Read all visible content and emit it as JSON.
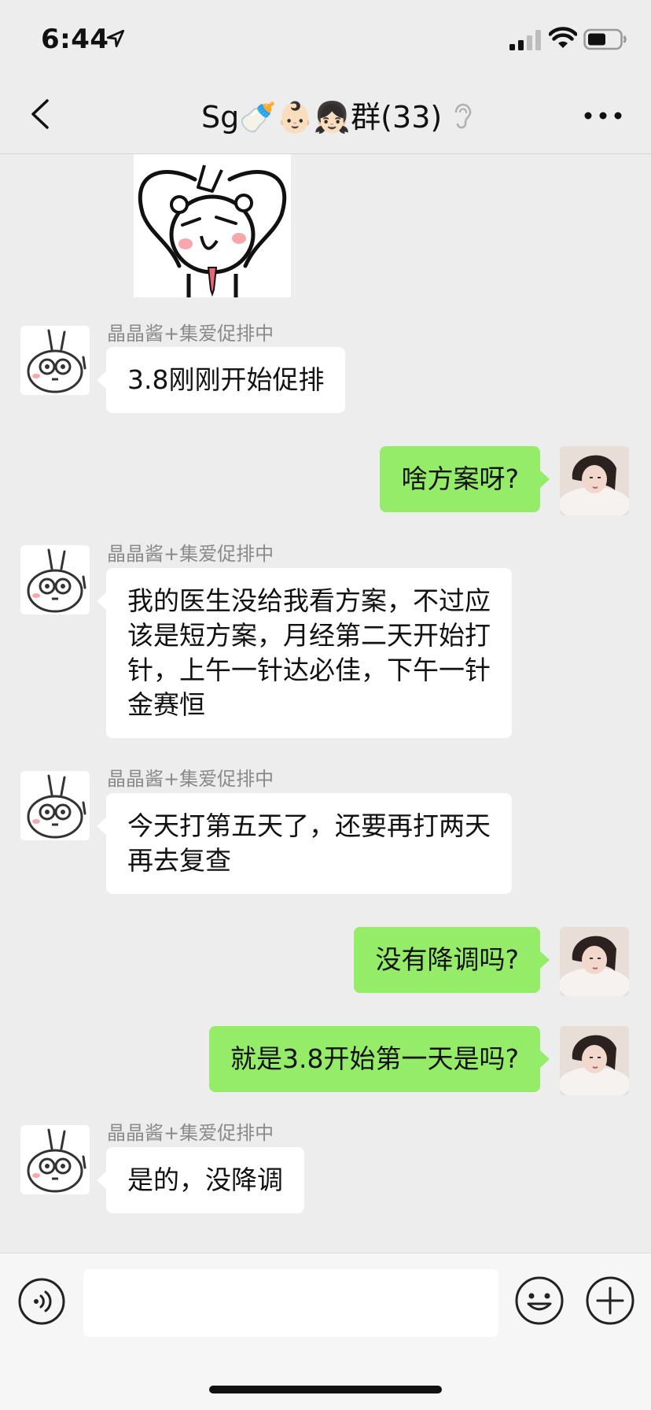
{
  "status_bar": {
    "time": "6:44",
    "icons": [
      "location-arrow-icon",
      "signal-icon",
      "wifi-icon",
      "battery-icon"
    ]
  },
  "nav": {
    "title": "Sg🍼👶🏻👧🏻群(33)",
    "back_icon": "chevron-left-icon",
    "mute_icon": "ear-icon",
    "more_icon": "ellipsis-icon"
  },
  "messages": [
    {
      "side": "in",
      "sender": "晶晶酱+集爱促排中",
      "lines": [
        "3.8刚刚开始促排"
      ]
    },
    {
      "side": "out",
      "lines": [
        "啥方案呀?"
      ]
    },
    {
      "side": "in",
      "sender": "晶晶酱+集爱促排中",
      "lines": [
        "我的医生没给我看方案，不过应",
        "该是短方案，月经第二天开始打",
        "针，上午一针达必佳，下午一针",
        "金赛恒"
      ]
    },
    {
      "side": "in",
      "sender": "晶晶酱+集爱促排中",
      "lines": [
        "今天打第五天了，还要再打两天",
        "再去复查"
      ]
    },
    {
      "side": "out",
      "lines": [
        "没有降调吗?"
      ]
    },
    {
      "side": "out",
      "lines": [
        "就是3.8开始第一天是吗?"
      ]
    },
    {
      "side": "in",
      "sender": "晶晶酱+集爱促排中",
      "lines": [
        "是的，没降调"
      ]
    }
  ],
  "input_bar": {
    "voice_icon": "voice-icon",
    "emoji_icon": "emoji-icon",
    "plus_icon": "plus-icon",
    "text_value": ""
  },
  "colors": {
    "background": "#ededed",
    "incoming_bubble": "#ffffff",
    "outgoing_bubble": "#95ec69",
    "sender_text": "#8a8a8a"
  }
}
